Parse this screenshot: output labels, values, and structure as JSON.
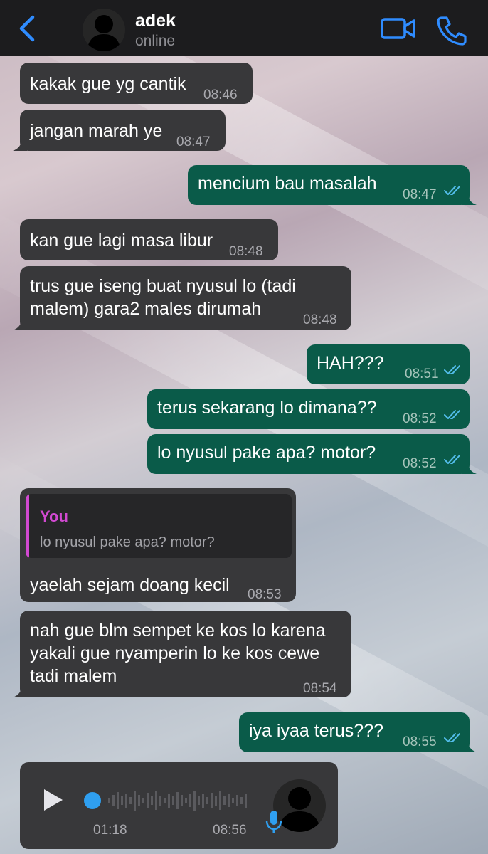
{
  "header": {
    "contact_name": "adek",
    "status": "online"
  },
  "messages": [
    {
      "dir": "in",
      "text": "kakak gue yg cantik",
      "time": "08:46"
    },
    {
      "dir": "in",
      "text": "jangan marah ye",
      "time": "08:47"
    },
    {
      "dir": "out",
      "text": "mencium bau masalah",
      "time": "08:47",
      "status": "read"
    },
    {
      "dir": "in",
      "text": "kan gue lagi masa libur",
      "time": "08:48"
    },
    {
      "dir": "in",
      "lines": [
        "trus gue iseng buat nyusul lo (tadi",
        "malem) gara2 males dirumah"
      ],
      "time": "08:48"
    },
    {
      "dir": "out",
      "text": "HAH???",
      "time": "08:51",
      "status": "read"
    },
    {
      "dir": "out",
      "text": "terus sekarang lo dimana??",
      "time": "08:52",
      "status": "read"
    },
    {
      "dir": "out",
      "text": "lo nyusul pake apa? motor?",
      "time": "08:52",
      "status": "read"
    },
    {
      "dir": "in",
      "reply_to": {
        "sender": "You",
        "text": "lo nyusul pake apa? motor?"
      },
      "text": "yaelah sejam doang kecil",
      "time": "08:53"
    },
    {
      "dir": "in",
      "lines": [
        "nah gue blm sempet ke kos lo karena",
        "yakali gue nyamperin lo ke kos cewe",
        "tadi malem"
      ],
      "time": "08:54"
    },
    {
      "dir": "out",
      "text": "iya iyaa terus???",
      "time": "08:55",
      "status": "read"
    }
  ],
  "voice_note": {
    "duration": "01:18",
    "time": "08:56",
    "progress": 0
  },
  "colors": {
    "incoming_bubble": "#38383a",
    "outgoing_bubble": "#0a5b49",
    "accent": "#2f8cff",
    "quote_accent": "#d149d1",
    "read_ticks": "#53bdeb"
  },
  "icons": [
    "back-chevron-icon",
    "video-call-icon",
    "phone-icon",
    "play-icon",
    "microphone-icon",
    "double-check-icon"
  ]
}
